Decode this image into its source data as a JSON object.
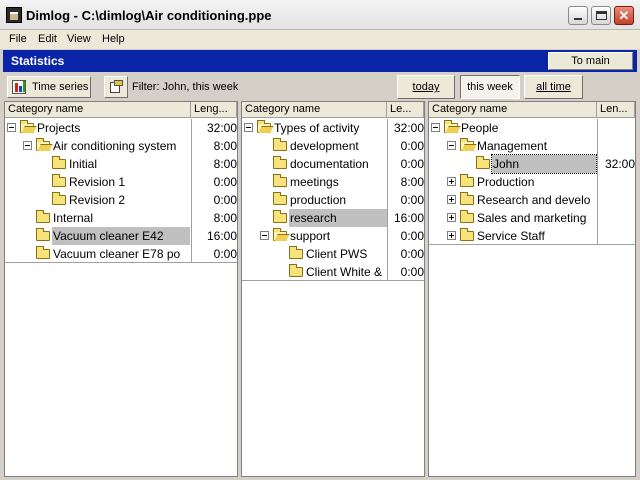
{
  "window": {
    "title": "Dimlog - C:\\dimlog\\Air conditioning.ppe",
    "close_glyph": "✕"
  },
  "menu": [
    "File",
    "Edit",
    "View",
    "Help"
  ],
  "header": {
    "title": "Statistics",
    "to_main": "To main"
  },
  "toolbar": {
    "time_series": "Time series",
    "filter_text": "Filter: John, this week",
    "today": "today",
    "this_week": "this week",
    "all_time": "all time",
    "selected_period": "this week"
  },
  "panels": [
    {
      "col_name": "Category name",
      "col_len": "Leng...",
      "rows": [
        {
          "label": "Projects",
          "value": "32:00"
        },
        {
          "label": "Air conditioning system",
          "value": "8:00"
        },
        {
          "label": "Initial",
          "value": "8:00"
        },
        {
          "label": "Revision 1",
          "value": "0:00"
        },
        {
          "label": "Revision 2",
          "value": "0:00"
        },
        {
          "label": "Internal",
          "value": "8:00"
        },
        {
          "label": "Vacuum cleaner E42",
          "value": "16:00"
        },
        {
          "label": "Vacuum cleaner E78 po",
          "value": "0:00"
        }
      ]
    },
    {
      "col_name": "Category name",
      "col_len": "Le...",
      "rows": [
        {
          "label": "Types of activity",
          "value": "32:00"
        },
        {
          "label": "development",
          "value": "0:00"
        },
        {
          "label": "documentation",
          "value": "0:00"
        },
        {
          "label": "meetings",
          "value": "8:00"
        },
        {
          "label": "production",
          "value": "0:00"
        },
        {
          "label": "research",
          "value": "16:00"
        },
        {
          "label": "support",
          "value": "0:00"
        },
        {
          "label": "Client PWS",
          "value": "0:00"
        },
        {
          "label": "Client White &",
          "value": "0:00"
        }
      ]
    },
    {
      "col_name": "Category name",
      "col_len": "Len...",
      "rows": [
        {
          "label": "People",
          "value": ""
        },
        {
          "label": "Management",
          "value": ""
        },
        {
          "label": "John",
          "value": "32:00"
        },
        {
          "label": "Production",
          "value": ""
        },
        {
          "label": "Research and develo",
          "value": ""
        },
        {
          "label": "Sales and marketing",
          "value": ""
        },
        {
          "label": "Service Staff",
          "value": ""
        }
      ]
    }
  ]
}
